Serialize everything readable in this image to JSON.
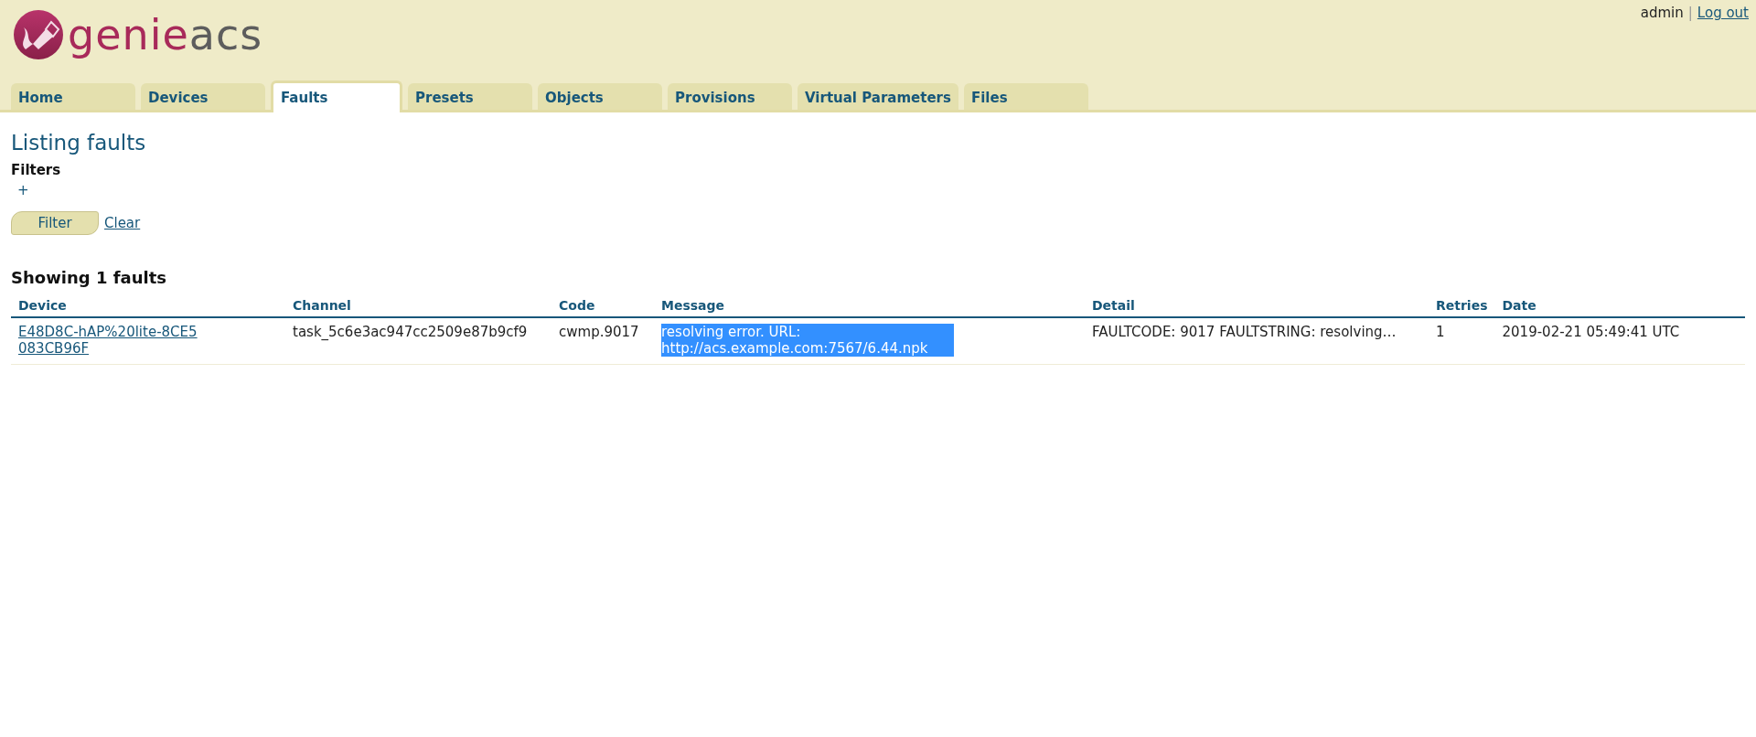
{
  "logo": {
    "primary": "genie",
    "secondary": "acs"
  },
  "user": {
    "name": "admin",
    "separator": "|",
    "logout": "Log out"
  },
  "tabs": [
    {
      "label": "Home",
      "selected": false
    },
    {
      "label": "Devices",
      "selected": false
    },
    {
      "label": "Faults",
      "selected": true
    },
    {
      "label": "Presets",
      "selected": false
    },
    {
      "label": "Objects",
      "selected": false
    },
    {
      "label": "Provisions",
      "selected": false
    },
    {
      "label": "Virtual Parameters",
      "selected": false
    },
    {
      "label": "Files",
      "selected": false
    }
  ],
  "page_title": "Listing faults",
  "filters": {
    "label": "Filters",
    "add": "+",
    "filter_button": "Filter",
    "clear": "Clear"
  },
  "table": {
    "caption": "Showing 1 faults",
    "columns": [
      "Device",
      "Channel",
      "Code",
      "Message",
      "Detail",
      "Retries",
      "Date"
    ],
    "rows": [
      {
        "device": "E48D8C-hAP%20lite-8CE5083CB96F",
        "channel": "task_5c6e3ac947cc2509e87b9cf9",
        "code": "cwmp.9017",
        "message": "resolving error. URL: http://acs.example.com:7567/6.44.npk",
        "message_selected": true,
        "detail": "FAULTCODE: 9017 FAULTSTRING: resolving…",
        "retries": "1",
        "date": "2019-02-21 05:49:41 UTC"
      }
    ]
  }
}
